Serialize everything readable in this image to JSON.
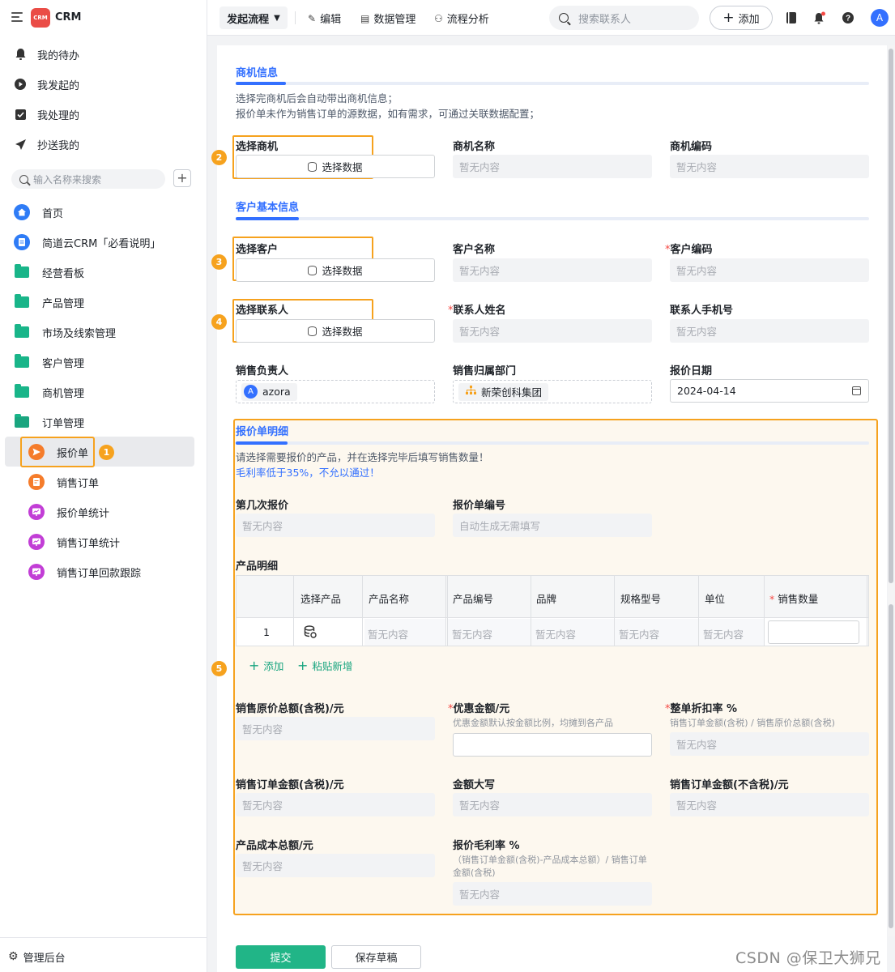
{
  "app": {
    "logo_text": "CRM",
    "name": "CRM"
  },
  "sidebar": {
    "quick": [
      {
        "label": "我的待办",
        "icon": "bell-icon"
      },
      {
        "label": "我发起的",
        "icon": "play-icon"
      },
      {
        "label": "我处理的",
        "icon": "check-box-icon"
      },
      {
        "label": "抄送我的",
        "icon": "send-icon"
      }
    ],
    "search_placeholder": "输入名称来搜索",
    "add_symbol": "+",
    "nav": [
      {
        "label": "首页",
        "icon": "home-icon"
      },
      {
        "label": "简道云CRM「必看说明」",
        "icon": "doc-icon"
      },
      {
        "label": "经营看板",
        "icon": "folder-icon"
      },
      {
        "label": "产品管理",
        "icon": "folder-icon"
      },
      {
        "label": "市场及线索管理",
        "icon": "folder-icon"
      },
      {
        "label": "客户管理",
        "icon": "folder-icon"
      },
      {
        "label": "商机管理",
        "icon": "folder-icon"
      },
      {
        "label": "订单管理",
        "icon": "folder-open-icon"
      }
    ],
    "sub": [
      {
        "label": "报价单",
        "icon": "send-circle-icon",
        "color": "#f57c2b"
      },
      {
        "label": "销售订单",
        "icon": "form-icon",
        "color": "#f57c2b"
      },
      {
        "label": "报价单统计",
        "icon": "chart-icon",
        "color": "#c23ed6"
      },
      {
        "label": "销售订单统计",
        "icon": "chart-icon",
        "color": "#c23ed6"
      },
      {
        "label": "销售订单回款跟踪",
        "icon": "chart-icon",
        "color": "#c23ed6"
      }
    ],
    "admin_label": "管理后台"
  },
  "badges": [
    "1",
    "2",
    "3",
    "4",
    "5"
  ],
  "topbar": {
    "flow_label": "发起流程",
    "edit_label": "编辑",
    "data_label": "数据管理",
    "analysis_label": "流程分析",
    "search_placeholder": "搜索联系人",
    "add_label": "添加",
    "avatar_letter": "A"
  },
  "form": {
    "opportunity": {
      "title": "商机信息",
      "desc1": "选择完商机后会自动带出商机信息；",
      "desc2": "报价单未作为销售订单的源数据，如有需求，可通过关联数据配置；",
      "select_label": "选择商机",
      "name_label": "商机名称",
      "code_label": "商机编码"
    },
    "customer": {
      "title": "客户基本信息",
      "select_label": "选择客户",
      "name_label": "客户名称",
      "code_label": "客户编码",
      "contact_label": "选择联系人",
      "contact_name_label": "联系人姓名",
      "contact_phone_label": "联系人手机号",
      "owner_label": "销售负责人",
      "owner_name": "azora",
      "owner_avatar": "A",
      "dept_label": "销售归属部门",
      "dept_name": "新荣创科集团",
      "date_label": "报价日期",
      "date_value": "2024-04-14"
    },
    "select_data_label": "选择数据",
    "empty_text": "暂无内容",
    "required_mark": "*",
    "detail": {
      "title": "报价单明细",
      "desc": "请选择需要报价的产品，并在选择完毕后填写销售数量！",
      "warn": "毛利率低于35%，不允以通过！",
      "round_label": "第几次报价",
      "number_label": "报价单编号",
      "number_placeholder": "自动生成无需填写",
      "product_detail_label": "产品明细",
      "columns": [
        "选择产品",
        "产品名称",
        "产品编号",
        "品牌",
        "规格型号",
        "单位",
        "销售数量"
      ],
      "row_index": "1",
      "add_label": "添加",
      "paste_label": "粘贴新增",
      "orig_total_label": "销售原价总额(含税)/元",
      "discount_label": "优惠金额/元",
      "discount_hint": "优惠金额默认按金额比例，均摊到各产品",
      "rate_label": "整单折扣率 %",
      "rate_hint": "销售订单金额(含税) / 销售原价总额(含税)",
      "order_amount_label": "销售订单金额(含税)/元",
      "capital_label": "金额大写",
      "order_amount_ex_label": "销售订单金额(不含税)/元",
      "cost_label": "产品成本总额/元",
      "margin_label": "报价毛利率 %",
      "margin_hint1": "（销售订单金额(含税)-产品成本总额）/ 销售订单",
      "margin_hint2": "金额(含税)"
    },
    "submit_label": "提交",
    "draft_label": "保存草稿"
  },
  "watermark": "CSDN @保卫大狮兄"
}
